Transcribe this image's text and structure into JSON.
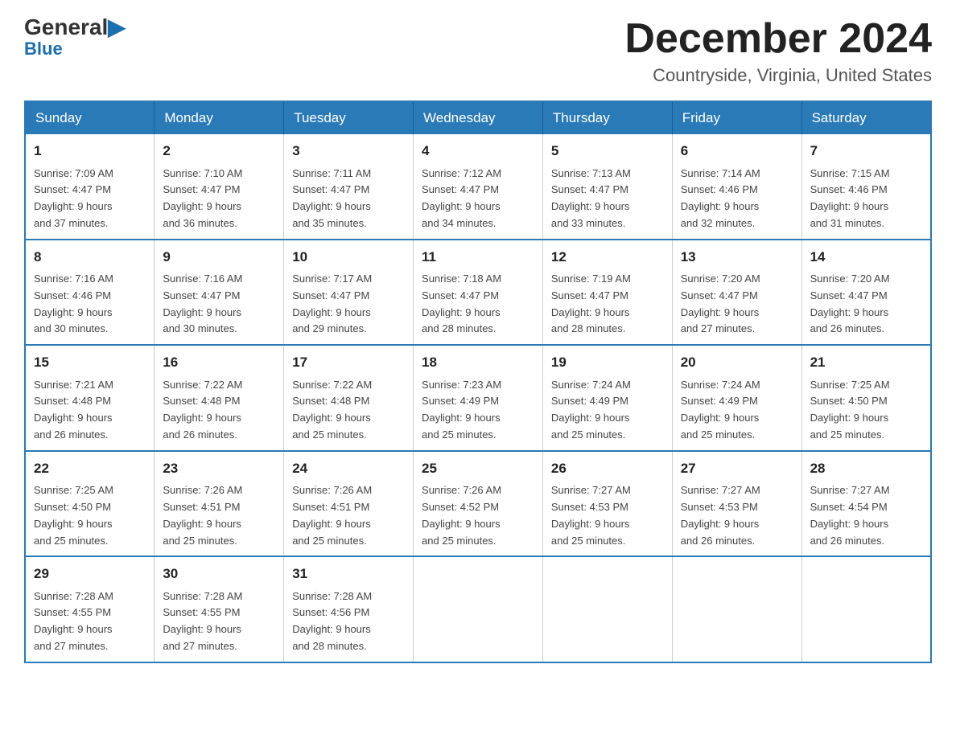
{
  "logo": {
    "general": "General",
    "blue": "Blue"
  },
  "header": {
    "month_year": "December 2024",
    "location": "Countryside, Virginia, United States"
  },
  "weekdays": [
    "Sunday",
    "Monday",
    "Tuesday",
    "Wednesday",
    "Thursday",
    "Friday",
    "Saturday"
  ],
  "weeks": [
    [
      {
        "day": "1",
        "sunrise": "Sunrise: 7:09 AM",
        "sunset": "Sunset: 4:47 PM",
        "daylight": "Daylight: 9 hours",
        "daylight2": "and 37 minutes."
      },
      {
        "day": "2",
        "sunrise": "Sunrise: 7:10 AM",
        "sunset": "Sunset: 4:47 PM",
        "daylight": "Daylight: 9 hours",
        "daylight2": "and 36 minutes."
      },
      {
        "day": "3",
        "sunrise": "Sunrise: 7:11 AM",
        "sunset": "Sunset: 4:47 PM",
        "daylight": "Daylight: 9 hours",
        "daylight2": "and 35 minutes."
      },
      {
        "day": "4",
        "sunrise": "Sunrise: 7:12 AM",
        "sunset": "Sunset: 4:47 PM",
        "daylight": "Daylight: 9 hours",
        "daylight2": "and 34 minutes."
      },
      {
        "day": "5",
        "sunrise": "Sunrise: 7:13 AM",
        "sunset": "Sunset: 4:47 PM",
        "daylight": "Daylight: 9 hours",
        "daylight2": "and 33 minutes."
      },
      {
        "day": "6",
        "sunrise": "Sunrise: 7:14 AM",
        "sunset": "Sunset: 4:46 PM",
        "daylight": "Daylight: 9 hours",
        "daylight2": "and 32 minutes."
      },
      {
        "day": "7",
        "sunrise": "Sunrise: 7:15 AM",
        "sunset": "Sunset: 4:46 PM",
        "daylight": "Daylight: 9 hours",
        "daylight2": "and 31 minutes."
      }
    ],
    [
      {
        "day": "8",
        "sunrise": "Sunrise: 7:16 AM",
        "sunset": "Sunset: 4:46 PM",
        "daylight": "Daylight: 9 hours",
        "daylight2": "and 30 minutes."
      },
      {
        "day": "9",
        "sunrise": "Sunrise: 7:16 AM",
        "sunset": "Sunset: 4:47 PM",
        "daylight": "Daylight: 9 hours",
        "daylight2": "and 30 minutes."
      },
      {
        "day": "10",
        "sunrise": "Sunrise: 7:17 AM",
        "sunset": "Sunset: 4:47 PM",
        "daylight": "Daylight: 9 hours",
        "daylight2": "and 29 minutes."
      },
      {
        "day": "11",
        "sunrise": "Sunrise: 7:18 AM",
        "sunset": "Sunset: 4:47 PM",
        "daylight": "Daylight: 9 hours",
        "daylight2": "and 28 minutes."
      },
      {
        "day": "12",
        "sunrise": "Sunrise: 7:19 AM",
        "sunset": "Sunset: 4:47 PM",
        "daylight": "Daylight: 9 hours",
        "daylight2": "and 28 minutes."
      },
      {
        "day": "13",
        "sunrise": "Sunrise: 7:20 AM",
        "sunset": "Sunset: 4:47 PM",
        "daylight": "Daylight: 9 hours",
        "daylight2": "and 27 minutes."
      },
      {
        "day": "14",
        "sunrise": "Sunrise: 7:20 AM",
        "sunset": "Sunset: 4:47 PM",
        "daylight": "Daylight: 9 hours",
        "daylight2": "and 26 minutes."
      }
    ],
    [
      {
        "day": "15",
        "sunrise": "Sunrise: 7:21 AM",
        "sunset": "Sunset: 4:48 PM",
        "daylight": "Daylight: 9 hours",
        "daylight2": "and 26 minutes."
      },
      {
        "day": "16",
        "sunrise": "Sunrise: 7:22 AM",
        "sunset": "Sunset: 4:48 PM",
        "daylight": "Daylight: 9 hours",
        "daylight2": "and 26 minutes."
      },
      {
        "day": "17",
        "sunrise": "Sunrise: 7:22 AM",
        "sunset": "Sunset: 4:48 PM",
        "daylight": "Daylight: 9 hours",
        "daylight2": "and 25 minutes."
      },
      {
        "day": "18",
        "sunrise": "Sunrise: 7:23 AM",
        "sunset": "Sunset: 4:49 PM",
        "daylight": "Daylight: 9 hours",
        "daylight2": "and 25 minutes."
      },
      {
        "day": "19",
        "sunrise": "Sunrise: 7:24 AM",
        "sunset": "Sunset: 4:49 PM",
        "daylight": "Daylight: 9 hours",
        "daylight2": "and 25 minutes."
      },
      {
        "day": "20",
        "sunrise": "Sunrise: 7:24 AM",
        "sunset": "Sunset: 4:49 PM",
        "daylight": "Daylight: 9 hours",
        "daylight2": "and 25 minutes."
      },
      {
        "day": "21",
        "sunrise": "Sunrise: 7:25 AM",
        "sunset": "Sunset: 4:50 PM",
        "daylight": "Daylight: 9 hours",
        "daylight2": "and 25 minutes."
      }
    ],
    [
      {
        "day": "22",
        "sunrise": "Sunrise: 7:25 AM",
        "sunset": "Sunset: 4:50 PM",
        "daylight": "Daylight: 9 hours",
        "daylight2": "and 25 minutes."
      },
      {
        "day": "23",
        "sunrise": "Sunrise: 7:26 AM",
        "sunset": "Sunset: 4:51 PM",
        "daylight": "Daylight: 9 hours",
        "daylight2": "and 25 minutes."
      },
      {
        "day": "24",
        "sunrise": "Sunrise: 7:26 AM",
        "sunset": "Sunset: 4:51 PM",
        "daylight": "Daylight: 9 hours",
        "daylight2": "and 25 minutes."
      },
      {
        "day": "25",
        "sunrise": "Sunrise: 7:26 AM",
        "sunset": "Sunset: 4:52 PM",
        "daylight": "Daylight: 9 hours",
        "daylight2": "and 25 minutes."
      },
      {
        "day": "26",
        "sunrise": "Sunrise: 7:27 AM",
        "sunset": "Sunset: 4:53 PM",
        "daylight": "Daylight: 9 hours",
        "daylight2": "and 25 minutes."
      },
      {
        "day": "27",
        "sunrise": "Sunrise: 7:27 AM",
        "sunset": "Sunset: 4:53 PM",
        "daylight": "Daylight: 9 hours",
        "daylight2": "and 26 minutes."
      },
      {
        "day": "28",
        "sunrise": "Sunrise: 7:27 AM",
        "sunset": "Sunset: 4:54 PM",
        "daylight": "Daylight: 9 hours",
        "daylight2": "and 26 minutes."
      }
    ],
    [
      {
        "day": "29",
        "sunrise": "Sunrise: 7:28 AM",
        "sunset": "Sunset: 4:55 PM",
        "daylight": "Daylight: 9 hours",
        "daylight2": "and 27 minutes."
      },
      {
        "day": "30",
        "sunrise": "Sunrise: 7:28 AM",
        "sunset": "Sunset: 4:55 PM",
        "daylight": "Daylight: 9 hours",
        "daylight2": "and 27 minutes."
      },
      {
        "day": "31",
        "sunrise": "Sunrise: 7:28 AM",
        "sunset": "Sunset: 4:56 PM",
        "daylight": "Daylight: 9 hours",
        "daylight2": "and 28 minutes."
      },
      null,
      null,
      null,
      null
    ]
  ]
}
